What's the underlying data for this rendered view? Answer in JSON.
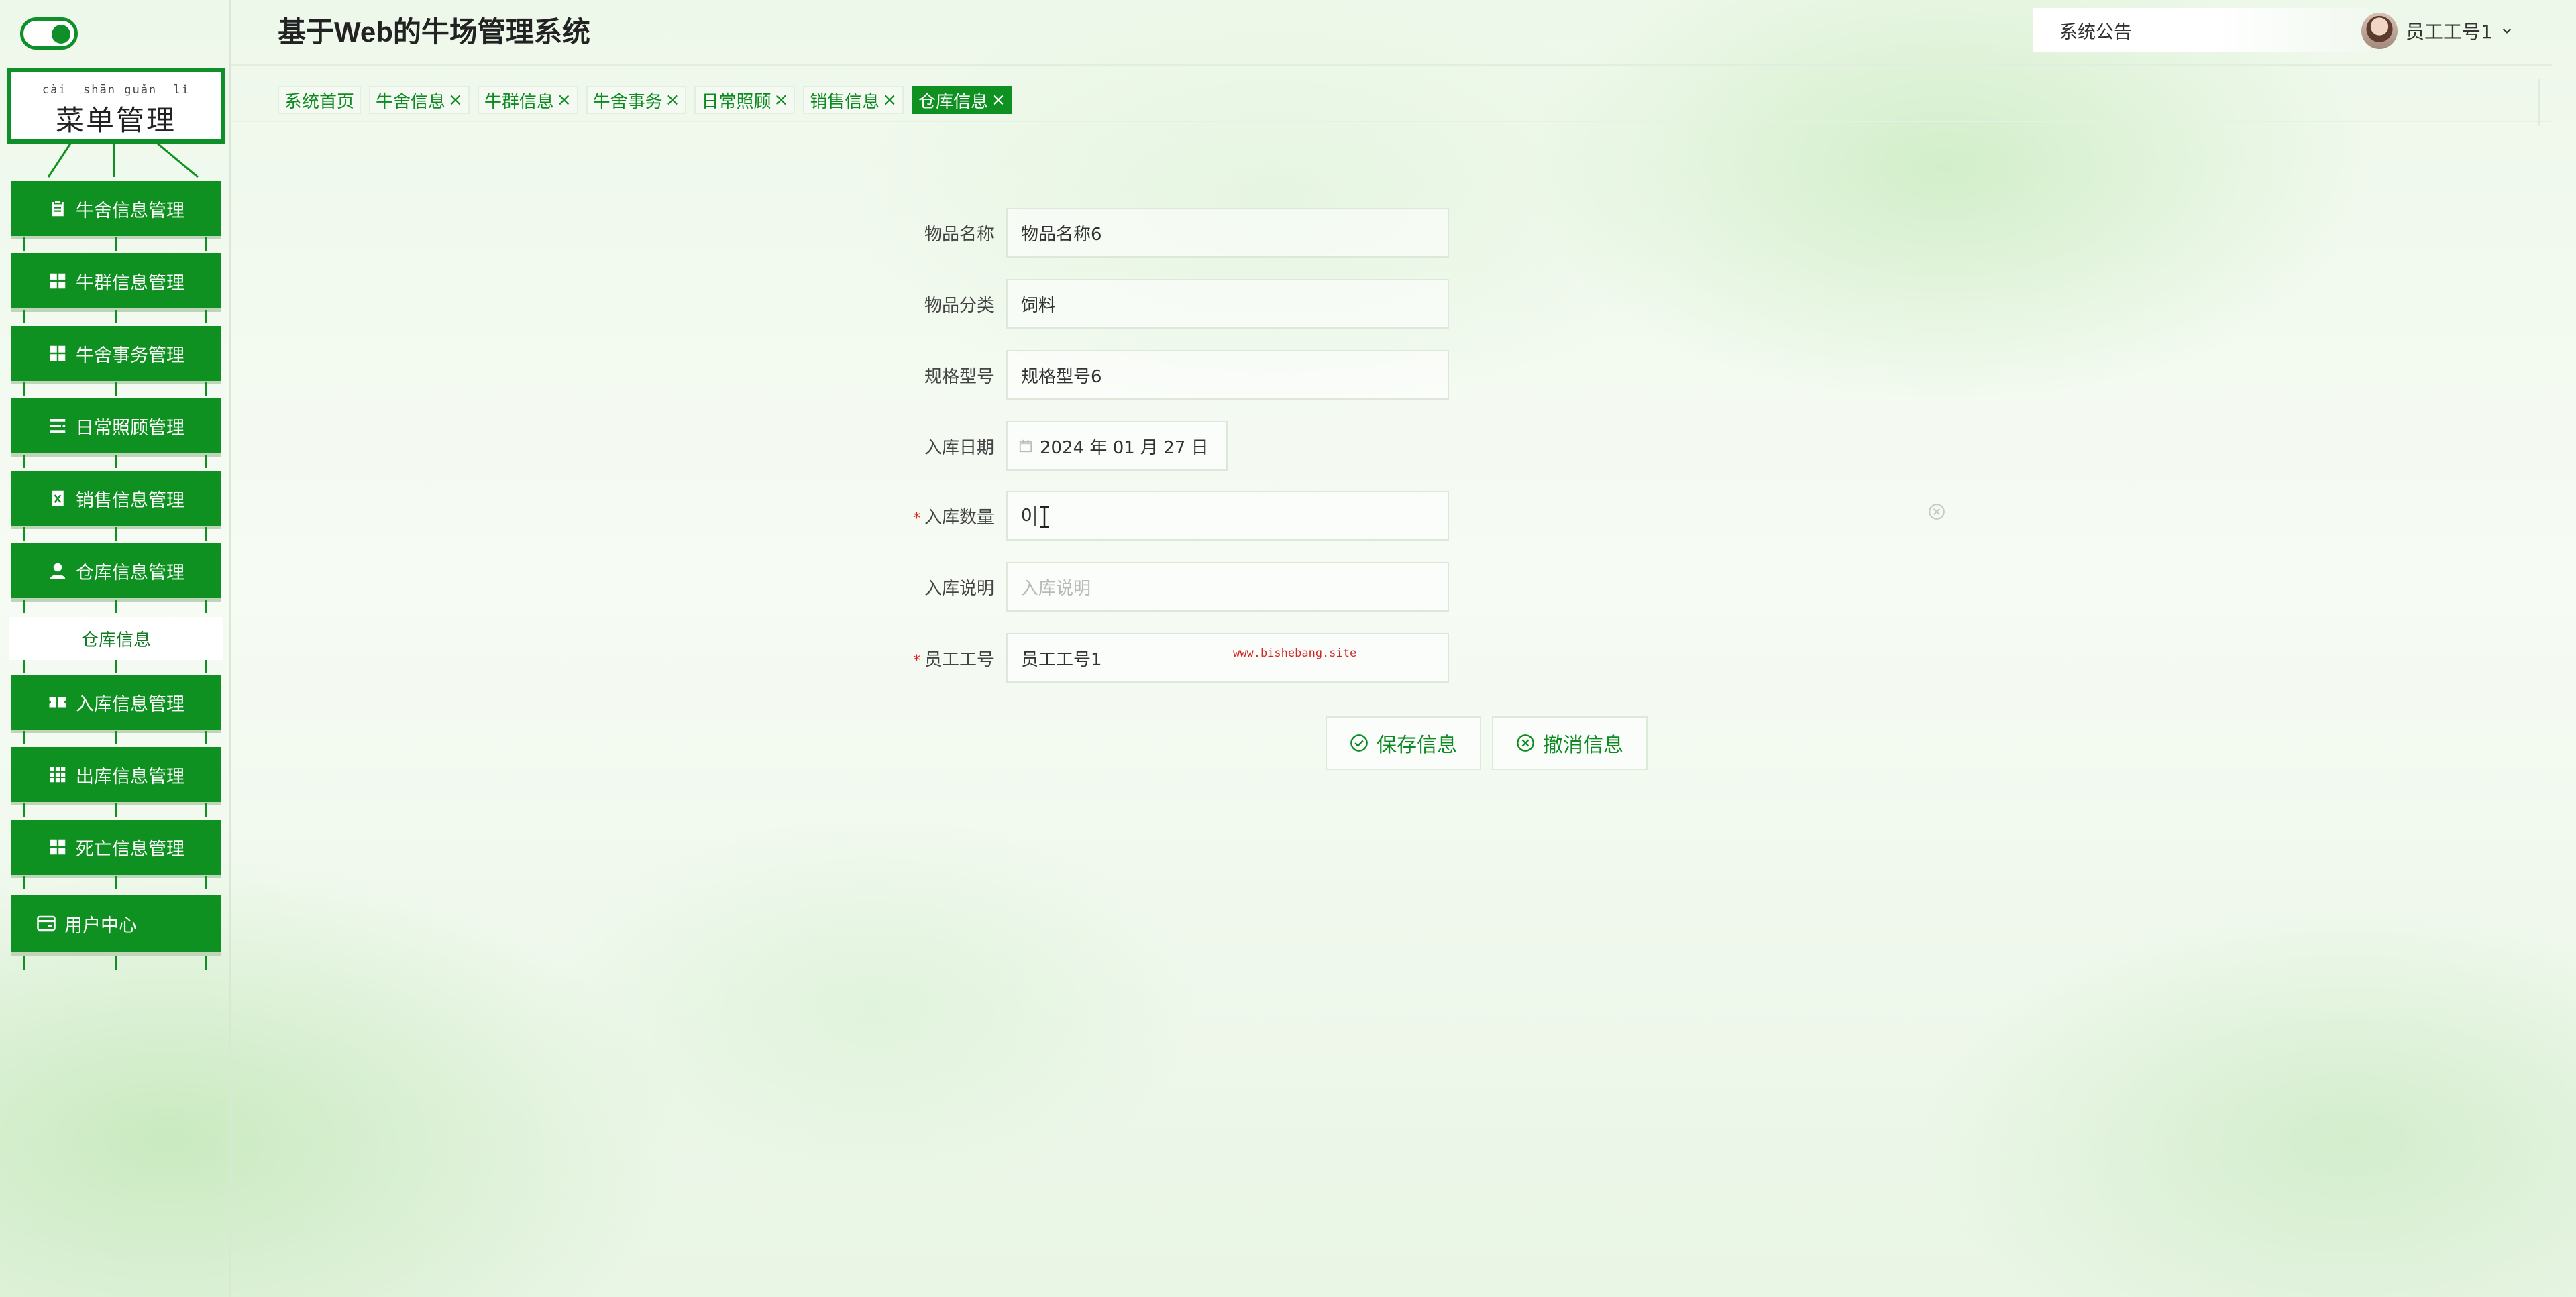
{
  "app": {
    "title": "基于Web的牛场管理系统"
  },
  "header": {
    "notice_label": "系统公告",
    "user_name": "员工工号1"
  },
  "sidebar": {
    "menu_title_pinyin": "cài  shān guǎn  lǐ",
    "menu_title": "菜单管理",
    "items": [
      {
        "label": "牛舍信息管理",
        "icon": "clipboard-icon"
      },
      {
        "label": "牛群信息管理",
        "icon": "grid-icon"
      },
      {
        "label": "牛舍事务管理",
        "icon": "grid-icon"
      },
      {
        "label": "日常照顾管理",
        "icon": "list-icon"
      },
      {
        "label": "销售信息管理",
        "icon": "document-x-icon"
      },
      {
        "label": "仓库信息管理",
        "icon": "person-icon"
      },
      {
        "label": "入库信息管理",
        "icon": "ticket-icon"
      },
      {
        "label": "出库信息管理",
        "icon": "apps-icon"
      },
      {
        "label": "死亡信息管理",
        "icon": "grid-icon"
      },
      {
        "label": "用户中心",
        "icon": "card-icon"
      }
    ],
    "sub_item": "仓库信息"
  },
  "tabs": [
    {
      "label": "系统首页",
      "closable": false,
      "active": false
    },
    {
      "label": "牛舍信息",
      "closable": true,
      "active": false
    },
    {
      "label": "牛群信息",
      "closable": true,
      "active": false
    },
    {
      "label": "牛舍事务",
      "closable": true,
      "active": false
    },
    {
      "label": "日常照顾",
      "closable": true,
      "active": false
    },
    {
      "label": "销售信息",
      "closable": true,
      "active": false
    },
    {
      "label": "仓库信息",
      "closable": true,
      "active": true
    }
  ],
  "form": {
    "item_name": {
      "label": "物品名称",
      "value": "物品名称6"
    },
    "category": {
      "label": "物品分类",
      "value": "饲料"
    },
    "spec": {
      "label": "规格型号",
      "value": "规格型号6"
    },
    "in_date": {
      "label": "入库日期",
      "value": "2024 年 01 月 27 日"
    },
    "quantity": {
      "label": "入库数量",
      "value": "0",
      "required": true
    },
    "description": {
      "label": "入库说明",
      "placeholder": "入库说明"
    },
    "employee_no": {
      "label": "员工工号",
      "value": "员工工号1",
      "required": true
    },
    "required_mark": "*",
    "watermark": "www.bishebang.site"
  },
  "buttons": {
    "save": "保存信息",
    "cancel": "撤消信息"
  },
  "colors": {
    "primary": "#0e9120",
    "text": "#333333",
    "required": "#e02020"
  }
}
